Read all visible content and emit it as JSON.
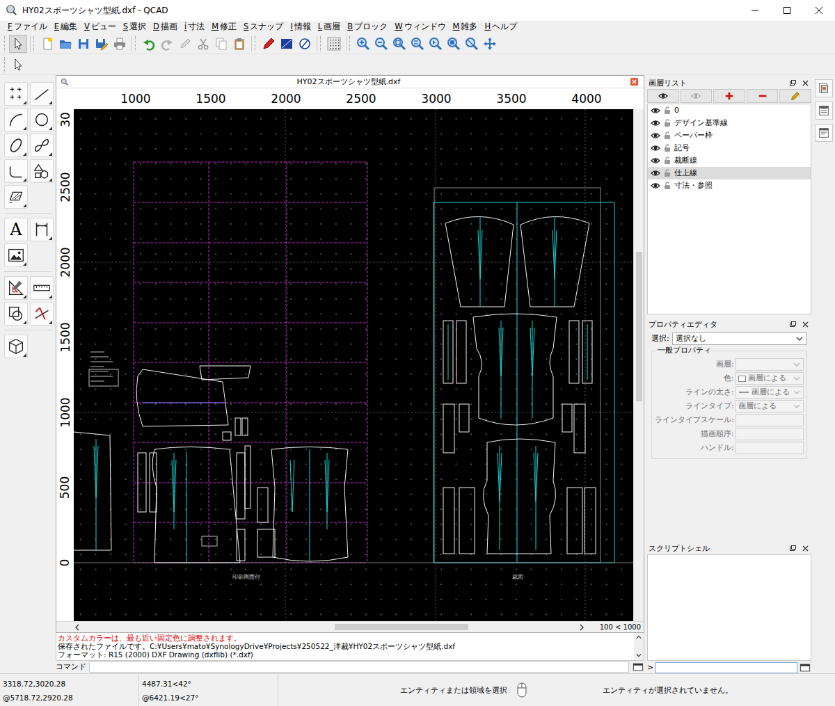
{
  "window": {
    "title": "HY02スポーツシャツ型紙.dxf - QCAD"
  },
  "menu": [
    {
      "key": "F",
      "label": "ファイル"
    },
    {
      "key": "E",
      "label": "編集"
    },
    {
      "key": "V",
      "label": "ビュー"
    },
    {
      "key": "S",
      "label": "選択"
    },
    {
      "key": "D",
      "label": "描画"
    },
    {
      "key": "i",
      "label": "寸法"
    },
    {
      "key": "M",
      "label": "修正"
    },
    {
      "key": "S",
      "label": "スナップ"
    },
    {
      "key": "I",
      "label": "情報"
    },
    {
      "key": "L",
      "label": "画層"
    },
    {
      "key": "B",
      "label": "ブロック"
    },
    {
      "key": "W",
      "label": "ウィンドウ"
    },
    {
      "key": "M",
      "label": "雑多"
    },
    {
      "key": "H",
      "label": "ヘルプ"
    }
  ],
  "toolbox": {
    "text_tool": "A"
  },
  "document": {
    "title": "HY02スポーツシャツ型紙.dxf",
    "ruler_x": [
      "1000",
      "1500",
      "2000",
      "2500",
      "3000",
      "3500",
      "4000"
    ],
    "ruler_y": [
      "30",
      "2500",
      "2000",
      "1500",
      "1000",
      "500",
      "0"
    ],
    "drawing_labels": [
      "印刷周囲付",
      "裁図"
    ],
    "zoom": "100 < 1000"
  },
  "history": [
    {
      "text": "カスタムカラーは、最も近い固定色に調整されます。",
      "kind": "warning"
    },
    {
      "text": "保存されたファイルです。C:¥Users¥mato¥SynologyDrive¥Projects¥250522_洋裁¥HY02スポーツシャツ型紙.dxf",
      "kind": "info"
    },
    {
      "text": "フォーマット: R15 (2000) DXF Drawing (dxflib) (*.dxf)",
      "kind": "info"
    }
  ],
  "command": {
    "label": "コマンド"
  },
  "layers": {
    "title": "画層リスト",
    "items": [
      {
        "name": "0",
        "visible": true,
        "locked": false,
        "selected": false
      },
      {
        "name": "デザイン基準線",
        "visible": true,
        "locked": false,
        "selected": false
      },
      {
        "name": "ペーパー枠",
        "visible": true,
        "locked": false,
        "selected": false
      },
      {
        "name": "記号",
        "visible": true,
        "locked": false,
        "selected": false
      },
      {
        "name": "裁断線",
        "visible": true,
        "locked": false,
        "selected": false
      },
      {
        "name": "仕上線",
        "visible": true,
        "locked": false,
        "selected": true
      },
      {
        "name": "寸法・参照",
        "visible": true,
        "locked": false,
        "selected": false
      }
    ]
  },
  "properties": {
    "title": "プロパティエディタ",
    "selection_label": "選択:",
    "selection": "選択なし",
    "group": "一般プロパティ",
    "rows": [
      {
        "label": "画層:",
        "kind": "select",
        "disabled": true
      },
      {
        "label": "色:",
        "value": "画層による",
        "kind": "color",
        "disabled": true
      },
      {
        "label": "ラインの太さ:",
        "value": "画層による",
        "kind": "lineweight",
        "disabled": true
      },
      {
        "label": "ラインタイプ:",
        "value": "画層による",
        "kind": "select",
        "disabled": true
      },
      {
        "label": "ラインタイプスケール:",
        "kind": "text",
        "disabled": true
      },
      {
        "label": "描画順序:",
        "kind": "text",
        "disabled": true
      },
      {
        "label": "ハンドル:",
        "kind": "text",
        "disabled": true
      }
    ]
  },
  "script": {
    "title": "スクリプトシェル",
    "prompt": ">"
  },
  "status": {
    "coords": [
      "3318.72,3020.28",
      "@5718.72,2920.28"
    ],
    "polar": [
      "4487.31<42°",
      "@6421.19<27°"
    ],
    "hint": "エンティティまたは領域を選択",
    "selection": "エンティティが選択されていません。"
  }
}
